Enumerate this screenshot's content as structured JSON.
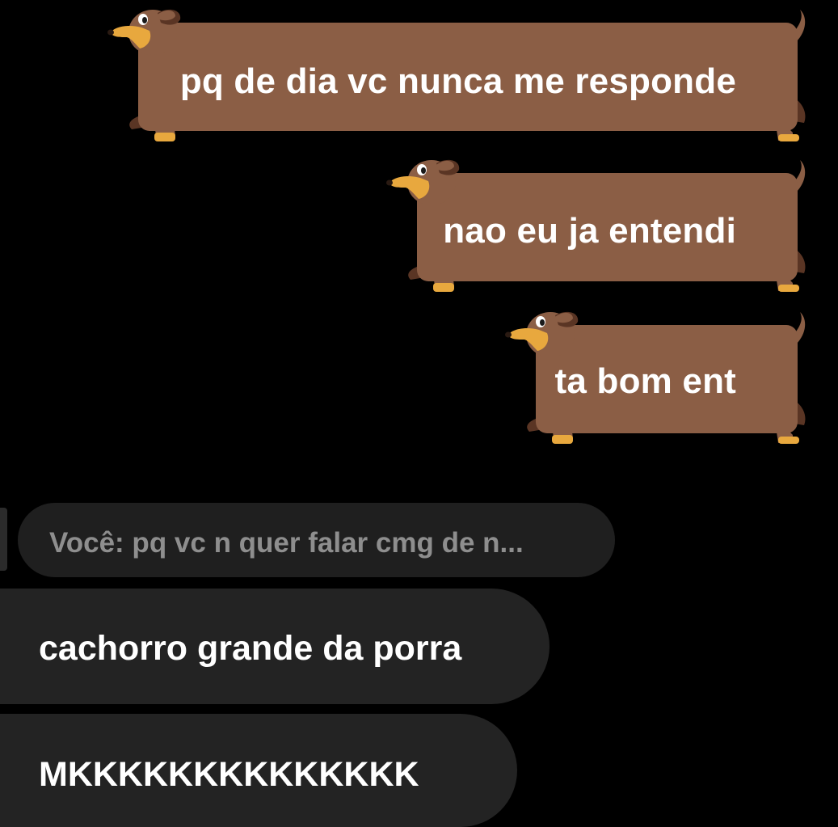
{
  "colors": {
    "background": "#000000",
    "dog_body": "#8b5e45",
    "dog_dark": "#5a3524",
    "dog_snout": "#e8a83e",
    "received_bubble": "#232323",
    "reply_bubble": "#1f1f1f",
    "reply_text": "#8e8e8e",
    "text": "#ffffff"
  },
  "sent_messages": [
    {
      "text": "pq de dia vc nunca me responde",
      "style": "dachshund-sticker"
    },
    {
      "text": "nao eu ja entendi",
      "style": "dachshund-sticker"
    },
    {
      "text": "ta bom ent",
      "style": "dachshund-sticker"
    }
  ],
  "reply_preview": {
    "text": "Você: pq vc n quer falar cmg de n..."
  },
  "received_messages": [
    {
      "text": "cachorro grande da porra"
    },
    {
      "text": "MKKKKKKKKKKKKKK"
    }
  ]
}
